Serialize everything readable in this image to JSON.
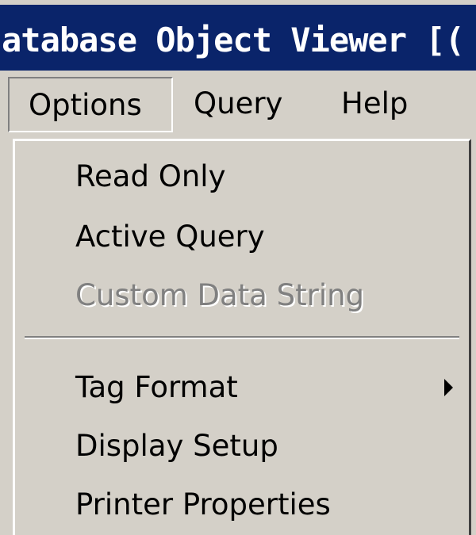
{
  "window": {
    "title": "atabase Object Viewer [("
  },
  "menubar": {
    "items": [
      {
        "label": "Options"
      },
      {
        "label": "Query"
      },
      {
        "label": "Help"
      }
    ]
  },
  "options_menu": {
    "items": [
      {
        "label": "Read Only",
        "enabled": true
      },
      {
        "label": "Active Query",
        "enabled": true
      },
      {
        "label": "Custom Data String",
        "enabled": false
      },
      {
        "label": "Tag Format",
        "enabled": true,
        "has_submenu": true
      },
      {
        "label": "Display Setup",
        "enabled": true
      },
      {
        "label": "Printer Properties",
        "enabled": true
      }
    ]
  },
  "colors": {
    "titlebar": "#0a246a",
    "menu_background": "#d4d0c8",
    "disabled_text": "#808080"
  }
}
